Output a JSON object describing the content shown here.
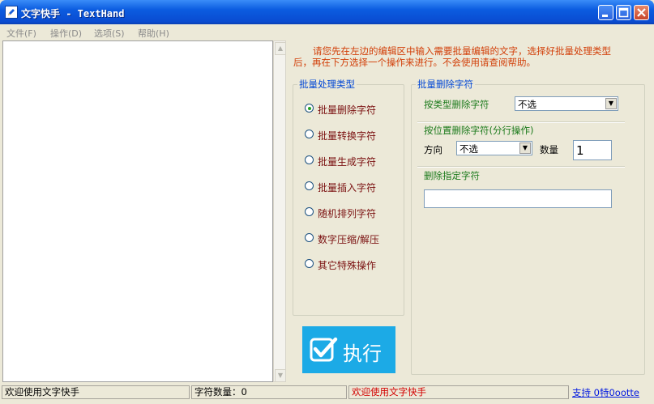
{
  "window": {
    "title": "文字快手 - TextHand",
    "colors": {
      "titlebar": "#0B5CE0",
      "accent": "#1CAAE6",
      "hint_text": "#D2400A",
      "group_title": "#0046D5",
      "option_text": "#7A1010",
      "field_label": "#1B7A1B"
    }
  },
  "menu": {
    "items": [
      {
        "label": "文件(F)"
      },
      {
        "label": "操作(D)"
      },
      {
        "label": "选项(S)"
      },
      {
        "label": "帮助(H)"
      }
    ]
  },
  "hint": "请您先在左边的编辑区中输入需要批量编辑的文字，选择好批量处理类型后，再在下方选择一个操作来进行。不会使用请查阅帮助。",
  "types": {
    "title": "批量处理类型",
    "selected_index": 0,
    "options": [
      {
        "label": "批量删除字符"
      },
      {
        "label": "批量转换字符"
      },
      {
        "label": "批量生成字符"
      },
      {
        "label": "批量插入字符"
      },
      {
        "label": "随机排列字符"
      },
      {
        "label": "数字压缩/解压"
      },
      {
        "label": "其它特殊操作"
      }
    ]
  },
  "panel": {
    "title": "批量删除字符",
    "by_type_label": "按类型删除字符",
    "by_type_value": "不选",
    "by_position_label": "按位置删除字符(分行操作)",
    "direction_label": "方向",
    "direction_value": "不选",
    "count_label": "数量",
    "count_value": "1",
    "specified_label": "删除指定字符",
    "specified_value": ""
  },
  "execute": {
    "label": "执行",
    "icon": "checkmark-icon"
  },
  "status": {
    "welcome": "欢迎使用文字快手",
    "char_count": "字符数量：0",
    "message": "欢迎使用文字快手",
    "support_link": "支持 0特0ootte"
  }
}
